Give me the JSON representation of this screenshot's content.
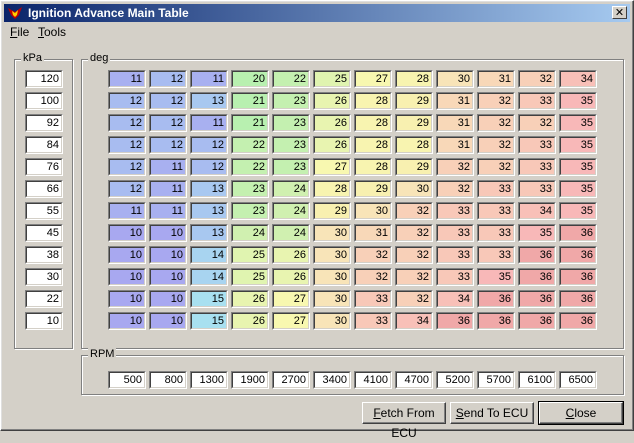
{
  "window": {
    "title": "Ignition Advance Main Table",
    "close_symbol": "✕"
  },
  "menu": [
    {
      "label": "File",
      "mnemonic": "F",
      "rest": "ile"
    },
    {
      "label": "Tools",
      "mnemonic": "T",
      "rest": "ools"
    }
  ],
  "kpa_group": {
    "label": "kPa",
    "values": [
      "120",
      "100",
      "92",
      "84",
      "76",
      "66",
      "55",
      "45",
      "38",
      "30",
      "22",
      "10"
    ]
  },
  "deg_group": {
    "label": "deg",
    "rows": [
      [
        "11",
        "12",
        "11",
        "20",
        "22",
        "25",
        "27",
        "28",
        "30",
        "31",
        "32",
        "34"
      ],
      [
        "12",
        "12",
        "13",
        "21",
        "23",
        "26",
        "28",
        "29",
        "31",
        "32",
        "33",
        "35"
      ],
      [
        "12",
        "12",
        "11",
        "21",
        "23",
        "26",
        "28",
        "29",
        "31",
        "32",
        "32",
        "35"
      ],
      [
        "12",
        "12",
        "12",
        "22",
        "23",
        "26",
        "28",
        "28",
        "31",
        "32",
        "33",
        "35"
      ],
      [
        "12",
        "11",
        "12",
        "22",
        "23",
        "27",
        "28",
        "29",
        "32",
        "32",
        "33",
        "35"
      ],
      [
        "12",
        "11",
        "13",
        "23",
        "24",
        "28",
        "29",
        "30",
        "32",
        "33",
        "33",
        "35"
      ],
      [
        "11",
        "11",
        "13",
        "23",
        "24",
        "29",
        "30",
        "32",
        "33",
        "33",
        "34",
        "35"
      ],
      [
        "10",
        "10",
        "13",
        "24",
        "24",
        "30",
        "31",
        "32",
        "33",
        "33",
        "35",
        "36"
      ],
      [
        "10",
        "10",
        "14",
        "25",
        "26",
        "30",
        "32",
        "32",
        "33",
        "33",
        "36",
        "36"
      ],
      [
        "10",
        "10",
        "14",
        "25",
        "26",
        "30",
        "32",
        "32",
        "33",
        "35",
        "36",
        "36"
      ],
      [
        "10",
        "10",
        "15",
        "26",
        "27",
        "30",
        "33",
        "32",
        "34",
        "36",
        "36",
        "36"
      ],
      [
        "10",
        "10",
        "15",
        "26",
        "27",
        "30",
        "33",
        "34",
        "36",
        "36",
        "36",
        "36"
      ]
    ]
  },
  "rpm_group": {
    "label": "RPM",
    "values": [
      "500",
      "800",
      "1300",
      "1900",
      "2700",
      "3400",
      "4100",
      "4700",
      "5200",
      "5700",
      "6100",
      "6500"
    ]
  },
  "buttons": {
    "fetch": {
      "label": "Fetch From ECU",
      "mnemonic": "F",
      "rest": "etch From ECU"
    },
    "send": {
      "label": "Send To ECU",
      "mnemonic": "S",
      "rest": "end To ECU"
    },
    "close": {
      "label": "Close",
      "mnemonic": "C",
      "rest": "lose"
    }
  },
  "colors": {
    "ramp": {
      "10": "#a8a8f0",
      "11": "#a8b0f0",
      "12": "#a8bcf0",
      "13": "#a8c8f0",
      "14": "#a8d4f0",
      "15": "#a8e0f0",
      "20": "#b8f0b0",
      "21": "#b8f0b0",
      "22": "#c4f0b0",
      "23": "#c4f0b0",
      "24": "#d0f0b0",
      "25": "#e0f4b0",
      "26": "#e8f4b0",
      "27": "#f8f8b0",
      "28": "#f8f4b0",
      "29": "#f8f0b0",
      "30": "#f8e4b8",
      "31": "#f8d8b8",
      "32": "#f8d0b8",
      "33": "#f8c8b8",
      "34": "#f8c0b8",
      "35": "#f8b8b8",
      "36": "#f0a8a8"
    }
  }
}
